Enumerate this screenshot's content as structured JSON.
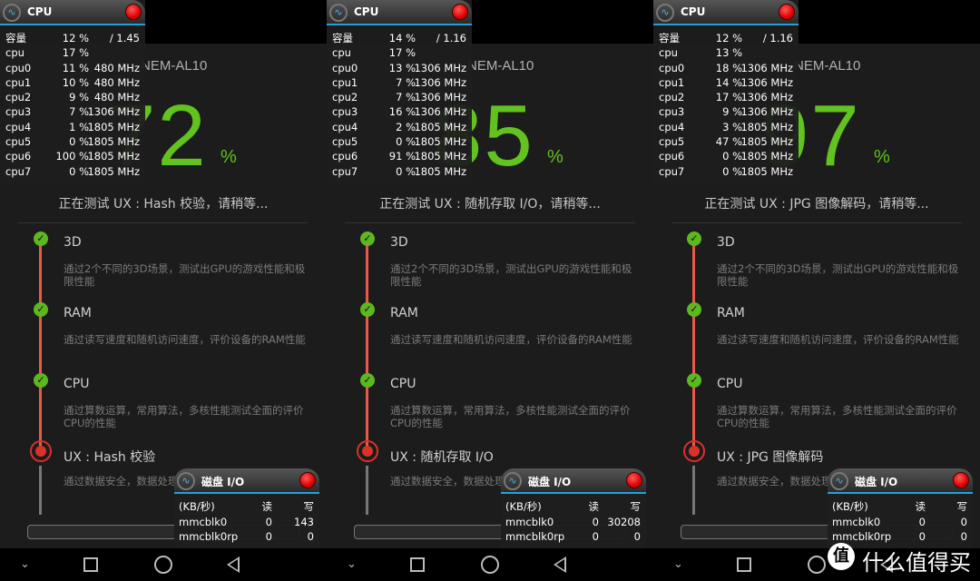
{
  "colors": {
    "score_green": "#62c21f",
    "timeline_red": "#e8594a",
    "accent_blue": "#2a9fd6"
  },
  "panels": [
    {
      "device": "NEM-AL10",
      "score": "72",
      "score_unit": "%",
      "status": "正在测试 UX : Hash 校验，请稍等...",
      "cpu": {
        "title": "CPU",
        "rows": [
          {
            "name": "容量",
            "pct": "12 %",
            "freq": "/ 1.45"
          },
          {
            "name": "cpu",
            "pct": "17 %",
            "freq": ""
          },
          {
            "name": "cpu0",
            "pct": "11 %",
            "freq": "480 MHz"
          },
          {
            "name": "cpu1",
            "pct": "10 %",
            "freq": "480 MHz"
          },
          {
            "name": "cpu2",
            "pct": "9 %",
            "freq": "480 MHz"
          },
          {
            "name": "cpu3",
            "pct": "7 %",
            "freq": "1306 MHz"
          },
          {
            "name": "cpu4",
            "pct": "1 %",
            "freq": "1805 MHz"
          },
          {
            "name": "cpu5",
            "pct": "0 %",
            "freq": "1805 MHz"
          },
          {
            "name": "cpu6",
            "pct": "100 %",
            "freq": "1805 MHz"
          },
          {
            "name": "cpu7",
            "pct": "0 %",
            "freq": "1805 MHz"
          }
        ]
      },
      "steps": [
        {
          "title": "3D",
          "desc": "通过2个不同的3D场景，测试出GPU的游戏性能和极限性能",
          "state": "done"
        },
        {
          "title": "RAM",
          "desc": "通过读写速度和随机访问速度，评价设备的RAM性能",
          "state": "done"
        },
        {
          "title": "CPU",
          "desc": "通过算数运算，常用算法，多核性能测试全面的评价CPU的性能",
          "state": "done"
        },
        {
          "title": "UX : Hash 校验",
          "desc": "通过数据安全，数据处理... 面综合评价设备的性能",
          "state": "running"
        }
      ],
      "disk": {
        "title": "磁盘 I/O",
        "header": {
          "unit": "(KB/秒)",
          "read": "读",
          "write": "写"
        },
        "rows": [
          {
            "name": "mmcblk0",
            "read": "0",
            "write": "143"
          },
          {
            "name": "mmcblk0rp",
            "read": "0",
            "write": "0"
          }
        ]
      }
    },
    {
      "device": "NEM-AL10",
      "score": "85",
      "score_unit": "%",
      "status": "正在测试 UX : 随机存取 I/O，请稍等...",
      "cpu": {
        "title": "CPU",
        "rows": [
          {
            "name": "容量",
            "pct": "14 %",
            "freq": "/ 1.16"
          },
          {
            "name": "cpu",
            "pct": "17 %",
            "freq": ""
          },
          {
            "name": "cpu0",
            "pct": "13 %",
            "freq": "1306 MHz"
          },
          {
            "name": "cpu1",
            "pct": "7 %",
            "freq": "1306 MHz"
          },
          {
            "name": "cpu2",
            "pct": "7 %",
            "freq": "1306 MHz"
          },
          {
            "name": "cpu3",
            "pct": "16 %",
            "freq": "1306 MHz"
          },
          {
            "name": "cpu4",
            "pct": "2 %",
            "freq": "1805 MHz"
          },
          {
            "name": "cpu5",
            "pct": "0 %",
            "freq": "1805 MHz"
          },
          {
            "name": "cpu6",
            "pct": "91 %",
            "freq": "1805 MHz"
          },
          {
            "name": "cpu7",
            "pct": "0 %",
            "freq": "1805 MHz"
          }
        ]
      },
      "steps": [
        {
          "title": "3D",
          "desc": "通过2个不同的3D场景，测试出GPU的游戏性能和极限性能",
          "state": "done"
        },
        {
          "title": "RAM",
          "desc": "通过读写速度和随机访问速度，评价设备的RAM性能",
          "state": "done"
        },
        {
          "title": "CPU",
          "desc": "通过算数运算，常用算法，多核性能测试全面的评价CPU的性能",
          "state": "done"
        },
        {
          "title": "UX : 随机存取 I/O",
          "desc": "通过数据安全，数据处理... 面综合评价设备的性能",
          "state": "running"
        }
      ],
      "disk": {
        "title": "磁盘 I/O",
        "header": {
          "unit": "(KB/秒)",
          "read": "读",
          "write": "写"
        },
        "rows": [
          {
            "name": "mmcblk0",
            "read": "0",
            "write": "30208"
          },
          {
            "name": "mmcblk0rp",
            "read": "0",
            "write": "0"
          }
        ]
      }
    },
    {
      "device": "NEM-AL10",
      "score": "97",
      "score_unit": "%",
      "status": "正在测试 UX : JPG 图像解码，请稍等...",
      "cpu": {
        "title": "CPU",
        "rows": [
          {
            "name": "容量",
            "pct": "12 %",
            "freq": "/ 1.16"
          },
          {
            "name": "cpu",
            "pct": "13 %",
            "freq": ""
          },
          {
            "name": "cpu0",
            "pct": "18 %",
            "freq": "1306 MHz"
          },
          {
            "name": "cpu1",
            "pct": "14 %",
            "freq": "1306 MHz"
          },
          {
            "name": "cpu2",
            "pct": "17 %",
            "freq": "1306 MHz"
          },
          {
            "name": "cpu3",
            "pct": "9 %",
            "freq": "1306 MHz"
          },
          {
            "name": "cpu4",
            "pct": "3 %",
            "freq": "1805 MHz"
          },
          {
            "name": "cpu5",
            "pct": "47 %",
            "freq": "1805 MHz"
          },
          {
            "name": "cpu6",
            "pct": "0 %",
            "freq": "1805 MHz"
          },
          {
            "name": "cpu7",
            "pct": "0 %",
            "freq": "1805 MHz"
          }
        ]
      },
      "steps": [
        {
          "title": "3D",
          "desc": "通过2个不同的3D场景，测试出GPU的游戏性能和极限性能",
          "state": "done"
        },
        {
          "title": "RAM",
          "desc": "通过读写速度和随机访问速度，评价设备的RAM性能",
          "state": "done"
        },
        {
          "title": "CPU",
          "desc": "通过算数运算，常用算法，多核性能测试全面的评价CPU的性能",
          "state": "done"
        },
        {
          "title": "UX : JPG 图像解码",
          "desc": "通过数据安全，数据处理... 面综合评价设备的性能",
          "state": "running"
        }
      ],
      "disk": {
        "title": "磁盘 I/O",
        "header": {
          "unit": "(KB/秒)",
          "read": "读",
          "write": "写"
        },
        "rows": [
          {
            "name": "mmcblk0",
            "read": "0",
            "write": "0"
          },
          {
            "name": "mmcblk0rp",
            "read": "0",
            "write": "0"
          }
        ]
      }
    }
  ],
  "icons": {
    "check": "✓",
    "pulse": "∿",
    "nav_down": "⌄"
  },
  "watermark": {
    "badge": "值",
    "text": "什么值得买"
  }
}
